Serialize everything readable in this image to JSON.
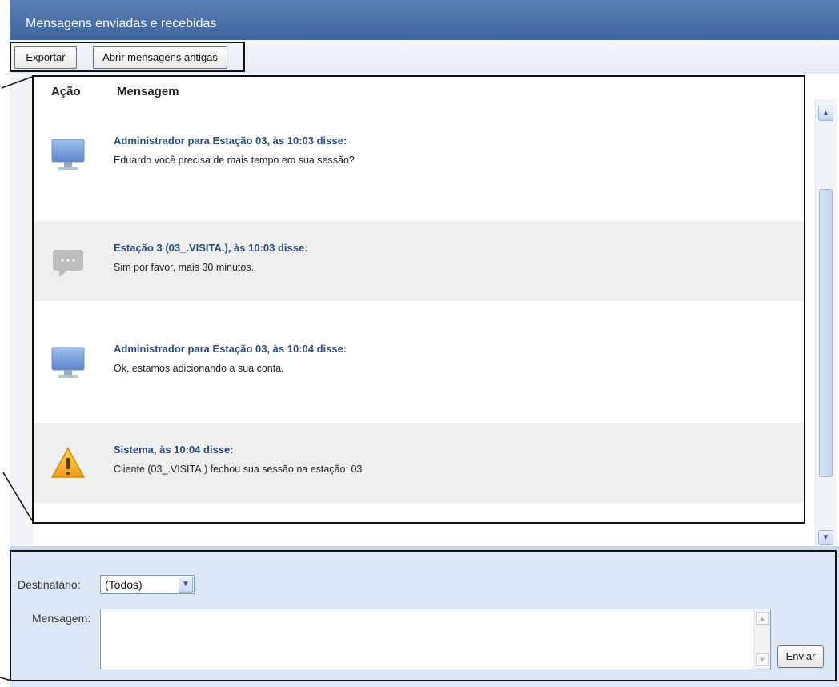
{
  "window": {
    "title": "Mensagens enviadas e recebidas"
  },
  "toolbar": {
    "export_label": "Exportar",
    "open_old_label": "Abrir mensagens antigas"
  },
  "list": {
    "col_action": "Ação",
    "col_message": "Mensagem",
    "messages": [
      {
        "icon": "monitor-icon",
        "title": "Administrador para Estação 03, às 10:03 disse:",
        "text": "Eduardo você precisa de mais tempo em sua sessão?",
        "shaded": false
      },
      {
        "icon": "speech-bubble-icon",
        "title": "Estação 3 (03_.VISITA.), às 10:03 disse:",
        "text": "Sim por favor, mais 30 minutos.",
        "shaded": true
      },
      {
        "icon": "monitor-icon",
        "title": "Administrador para Estação 03, às 10:04 disse:",
        "text": "Ok, estamos adicionando a sua conta.",
        "shaded": false
      },
      {
        "icon": "warning-icon",
        "title": "Sistema, às 10:04 disse:",
        "text": "Cliente (03_.VISITA.) fechou sua sessão na estação: 03",
        "shaded": true
      }
    ]
  },
  "composer": {
    "recipient_label": "Destinatário:",
    "recipient_value": "(Todos)",
    "message_label": "Mensagem:",
    "message_value": "",
    "send_label": "Enviar"
  },
  "colors": {
    "titlebar": "#4a6fa8",
    "composer_bg": "#dde8f7",
    "message_title": "#2b4a7c",
    "shaded_row": "#efefef",
    "warning": "#f6b21b"
  }
}
